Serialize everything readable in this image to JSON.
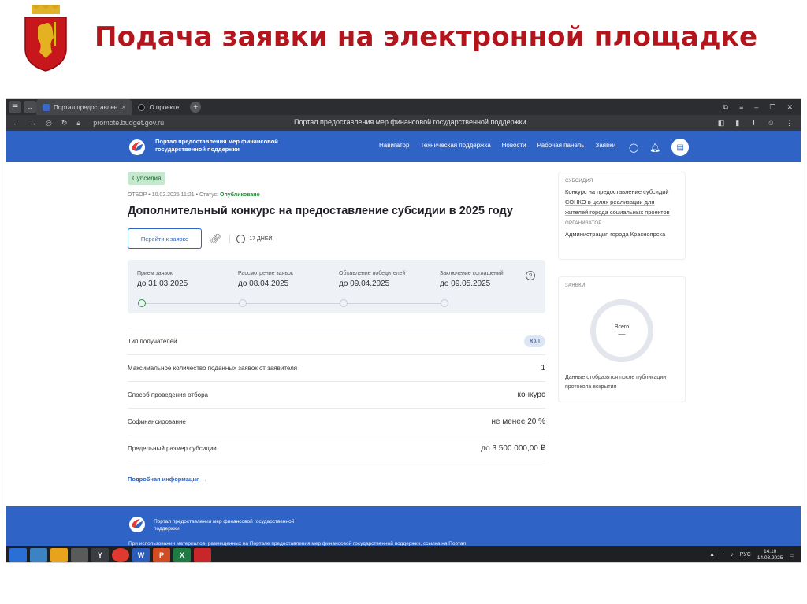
{
  "slide": {
    "title": "Подача заявки на электронной площадке"
  },
  "browser": {
    "tabs": [
      {
        "label": "Портал предоставлен",
        "close": "×"
      },
      {
        "label": "О проекте"
      }
    ],
    "new_tab": "+",
    "url": "promote.budget.gov.ru",
    "page_title": "Портал предоставления мер финансовой государственной поддержки"
  },
  "site": {
    "logo_text": "Портал предоставления мер финансовой государственной поддержки",
    "nav": [
      "Навигатор",
      "Техническая поддержка",
      "Новости",
      "Рабочая панель",
      "Заявки"
    ]
  },
  "main": {
    "badge": "Субсидия",
    "meta_prefix": "ОТБОР • 10.02.2025 11:21 • Статус:",
    "meta_status": "Опубликовано",
    "title": "Дополнительный конкурс на предоставление субсидии в 2025 году",
    "apply_button": "Перейти к заявке",
    "days": "17 ДНЕЙ",
    "stages": [
      {
        "label": "Прием заявок",
        "value": "до 31.03.2025",
        "done": true
      },
      {
        "label": "Рассмотрение заявок",
        "value": "до 08.04.2025",
        "done": false
      },
      {
        "label": "Объявление победителей",
        "value": "до 09.04.2025",
        "done": false
      },
      {
        "label": "Заключение соглашений",
        "value": "до 09.05.2025",
        "done": false
      }
    ],
    "help": "?",
    "rows": [
      {
        "key": "Тип получателей",
        "value": "ЮЛ"
      },
      {
        "key": "Максимальное количество поданных заявок от заявителя",
        "value": "1"
      },
      {
        "key": "Способ проведения отбора",
        "value": "конкурс"
      },
      {
        "key": "Софинансирование",
        "value": "не менее 20 %"
      },
      {
        "key": "Предельный размер субсидии",
        "value": "до 3 500 000,00 ₽"
      }
    ],
    "more_link": "Подробная информация →"
  },
  "side": {
    "subsidy_caption": "СУБСИДИЯ",
    "subsidy_text": "Конкурс на предоставление субсидий СОНКО в целях реализации для жителей города социальных проектов",
    "organizer_caption": "ОРГАНИЗАТОР",
    "organizer_text": "Администрация города Красноярска",
    "apps_caption": "ЗАЯВКИ",
    "donut_title": "Всего",
    "donut_value": "—",
    "apps_note": "Данные отобразятся после публикации протокола вскрытия"
  },
  "footer": {
    "logo_text": "Портал предоставления мер финансовой государственной поддержки",
    "note": "При использовании материалов, размещенных на Портале предоставления мер финансовой государственной поддержки, ссылка на Портал"
  },
  "taskbar": {
    "apps": [
      "",
      "",
      "",
      "",
      "Y",
      "",
      "W",
      "P",
      "X",
      ""
    ],
    "lang": "РУС",
    "time": "14:10",
    "date": "14.03.2025"
  },
  "colors": {
    "title_red": "#b3151c",
    "portal_blue": "#2f64c6",
    "badge_green": "#c5e8cf"
  }
}
